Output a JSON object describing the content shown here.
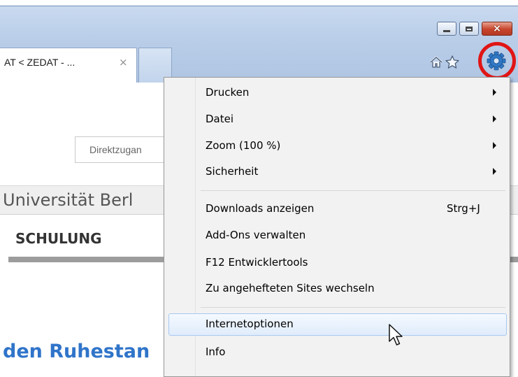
{
  "browser": {
    "tab_title": "AT < ZEDAT - ...",
    "tab_close": "×",
    "window_buttons": [
      "minimize-icon",
      "maximize-icon",
      "close-icon"
    ],
    "close_glyph": "×",
    "toolbar_icons": [
      "home-icon",
      "star-icon",
      "gear-icon"
    ],
    "highlight_color": "#e01515"
  },
  "page": {
    "search_placeholder": "Direktzugan",
    "university": "Universität Berl",
    "section": "SCHULUNG",
    "heading": "den Ruhestan"
  },
  "menu": {
    "groups": [
      [
        {
          "label": "Drucken",
          "submenu": true
        },
        {
          "label": "Datei",
          "submenu": true
        },
        {
          "label": "Zoom (100 %)",
          "submenu": true
        },
        {
          "label": "Sicherheit",
          "submenu": true
        }
      ],
      [
        {
          "label": "Downloads anzeigen",
          "shortcut": "Strg+J"
        },
        {
          "label": "Add-Ons verwalten"
        },
        {
          "label": "F12 Entwicklertools"
        },
        {
          "label": "Zu angehefteten Sites wechseln"
        }
      ],
      [
        {
          "label": "Internetoptionen",
          "highlighted": true
        },
        {
          "label": "Info"
        }
      ]
    ]
  }
}
